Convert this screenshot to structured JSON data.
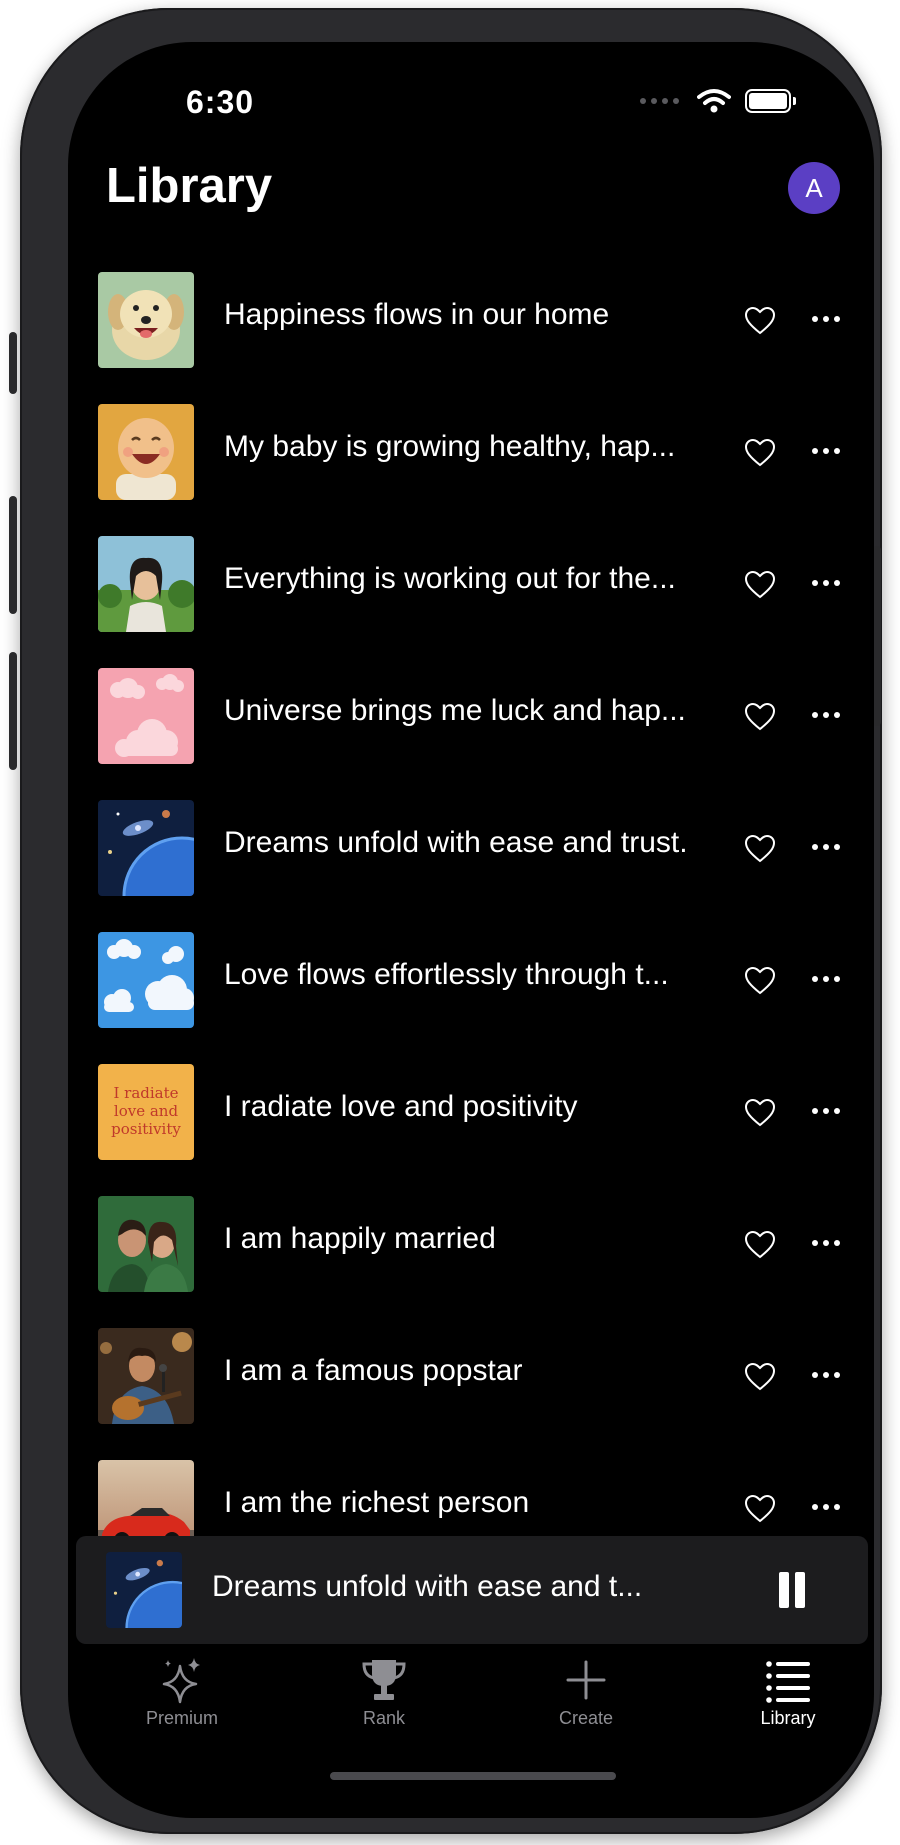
{
  "status_bar": {
    "time": "6:30"
  },
  "header": {
    "title": "Library",
    "avatar_initial": "A"
  },
  "tracks": [
    {
      "title": "Happiness flows in our home",
      "thumbnail": "smiling-dog-image"
    },
    {
      "title": "My baby is growing healthy, hap...",
      "thumbnail": "laughing-baby-image"
    },
    {
      "title": "Everything is working out for the...",
      "thumbnail": "girl-in-meadow-image"
    },
    {
      "title": "Universe brings me luck and hap...",
      "thumbnail": "pink-clouds-image"
    },
    {
      "title": "Dreams unfold with ease and trust.",
      "thumbnail": "galaxy-planet-image"
    },
    {
      "title": "Love flows effortlessly through t...",
      "thumbnail": "blue-sky-clouds-image"
    },
    {
      "title": "I radiate love and positivity",
      "thumbnail": "text-poster-image",
      "thumbnail_text": [
        "I radiate",
        "love and",
        "positivity"
      ]
    },
    {
      "title": "I am happily married",
      "thumbnail": "couple-image"
    },
    {
      "title": "I am a famous popstar",
      "thumbnail": "guitar-singer-image"
    },
    {
      "title": "I am the richest person",
      "thumbnail": "red-sports-car-image"
    }
  ],
  "now_playing": {
    "title": "Dreams unfold with ease and t...",
    "thumbnail": "galaxy-planet-image"
  },
  "tabs": [
    {
      "label": "Premium",
      "icon": "sparkles-icon",
      "active": false
    },
    {
      "label": "Rank",
      "icon": "trophy-icon",
      "active": false
    },
    {
      "label": "Create",
      "icon": "plus-icon",
      "active": false
    },
    {
      "label": "Library",
      "icon": "list-icon",
      "active": true
    }
  ],
  "colors": {
    "background": "#000000",
    "avatar": "#5b3fc4",
    "mini_player": "#1c1c1e",
    "inactive_tab": "#8e8e93"
  }
}
